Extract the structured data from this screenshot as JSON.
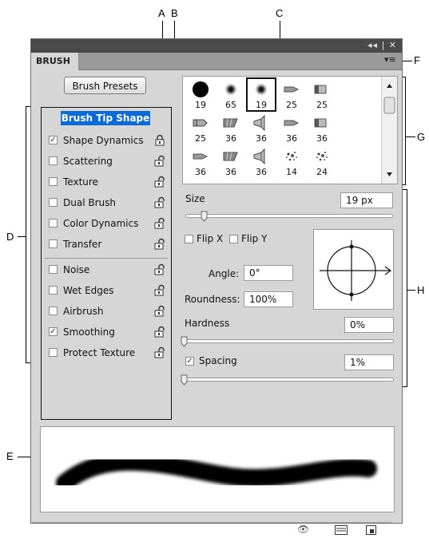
{
  "callouts": {
    "a": "A",
    "b": "B",
    "c": "C",
    "d": "D",
    "e": "E",
    "f": "F",
    "g": "G",
    "h": "H"
  },
  "panel": {
    "tab_label": "BRUSH",
    "window_controls": "◂◂ | ✕",
    "menu_glyph": "▾≡"
  },
  "presets_button": "Brush Presets",
  "options": {
    "brush_tip_shape": "Brush Tip Shape",
    "items": [
      {
        "label": "Shape Dynamics",
        "checked": true
      },
      {
        "label": "Scattering",
        "checked": false
      },
      {
        "label": "Texture",
        "checked": false
      },
      {
        "label": "Dual Brush",
        "checked": false
      },
      {
        "label": "Color Dynamics",
        "checked": false
      },
      {
        "label": "Transfer",
        "checked": false
      },
      {
        "label": "Noise",
        "checked": false
      },
      {
        "label": "Wet Edges",
        "checked": false
      },
      {
        "label": "Airbrush",
        "checked": false
      },
      {
        "label": "Smoothing",
        "checked": true
      },
      {
        "label": "Protect Texture",
        "checked": false
      }
    ]
  },
  "grid": {
    "cells": [
      {
        "num": "19",
        "icon": "hard-round"
      },
      {
        "num": "65",
        "icon": "soft-round"
      },
      {
        "num": "19",
        "icon": "soft-round"
      },
      {
        "num": "25",
        "icon": "pen"
      },
      {
        "num": "25",
        "icon": "flat"
      },
      {
        "num": "25",
        "icon": "flat-bristle"
      },
      {
        "num": "36",
        "icon": "fan"
      },
      {
        "num": "36",
        "icon": "round-bristle"
      },
      {
        "num": "36",
        "icon": "pen"
      },
      {
        "num": "36",
        "icon": "flat"
      },
      {
        "num": "36",
        "icon": "pen"
      },
      {
        "num": "36",
        "icon": "fan"
      },
      {
        "num": "36",
        "icon": "round-bristle"
      },
      {
        "num": "14",
        "icon": "splatter"
      },
      {
        "num": "24",
        "icon": "splatter"
      }
    ]
  },
  "size": {
    "label": "Size",
    "value": "19 px"
  },
  "flip": {
    "x_label": "Flip X",
    "y_label": "Flip Y"
  },
  "angle": {
    "label": "Angle:",
    "value": "0°"
  },
  "roundness": {
    "label": "Roundness:",
    "value": "100%"
  },
  "hardness": {
    "label": "Hardness",
    "value": "0%"
  },
  "spacing": {
    "label": "Spacing",
    "value": "1%",
    "checked": true
  },
  "colors": {
    "highlight": "#0a6ad8",
    "panel": "#d6d6d6"
  }
}
